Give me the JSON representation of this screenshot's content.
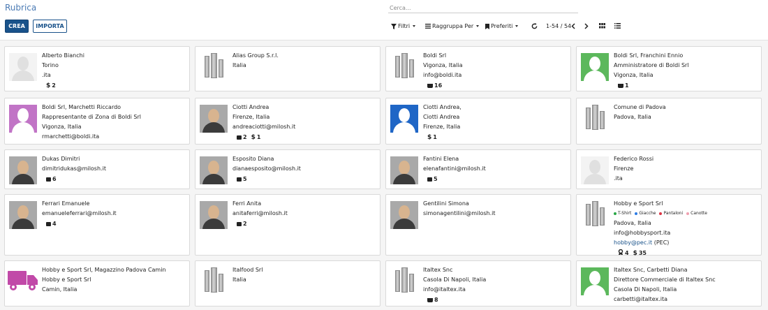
{
  "title": "Rubrica",
  "search": {
    "placeholder": "Cerca..."
  },
  "buttons": {
    "create": "CREA",
    "import": "IMPORTA"
  },
  "toolbar": {
    "filters": "Filtri",
    "group_by": "Raggruppa Per",
    "favorites": "Preferiti",
    "pager": "1-54 / 54"
  },
  "cards": [
    {
      "name": "Alberto Bianchi",
      "lines": [
        "Torino",
        ".ita"
      ],
      "badges": [
        {
          "icon": "dollar-icon",
          "value": "2"
        }
      ],
      "avatar": "person",
      "email": ""
    },
    {
      "name": "Alias Group S.r.l.",
      "lines": [
        "Italia"
      ],
      "badges": [],
      "avatar": "company",
      "email": ""
    },
    {
      "name": "Boldi Srl",
      "lines": [
        "Vigonza, Italia"
      ],
      "email": "info@boldi.ita",
      "badges": [
        {
          "icon": "cart-icon",
          "value": "16"
        }
      ],
      "avatar": "company"
    },
    {
      "name": "Boldi Srl, Franchini Ennio",
      "lines": [
        "Amministratore di Boldi Srl",
        "Vigonza, Italia"
      ],
      "email": "",
      "badges": [
        {
          "icon": "cart-icon",
          "value": "1"
        }
      ],
      "avatar": "green"
    },
    {
      "name": "Boldi Srl, Marchetti Riccardo",
      "lines": [
        "Rappresentante di Zona di Boldi Srl",
        "Vigonza, Italia"
      ],
      "email": "rmarchetti@boldi.ita",
      "badges": [],
      "avatar": "purple"
    },
    {
      "name": "Ciotti Andrea",
      "lines": [
        "Firenze, Italia"
      ],
      "email": "andreaciotti@milosh.it",
      "badges": [
        {
          "icon": "calendar-icon",
          "value": "2"
        },
        {
          "icon": "dollar-icon",
          "value": "1"
        }
      ],
      "avatar": "photo"
    },
    {
      "name": "Ciotti Andrea,",
      "lines": [
        "Ciotti Andrea",
        "Firenze, Italia"
      ],
      "email": "",
      "badges": [
        {
          "icon": "dollar-icon",
          "value": "1"
        }
      ],
      "avatar": "blue"
    },
    {
      "name": "Comune di Padova",
      "lines": [
        "Padova, Italia"
      ],
      "email": "",
      "badges": [],
      "avatar": "company"
    },
    {
      "name": "Dukas Dimitri",
      "lines": [],
      "email": "dimitridukas@milosh.it",
      "badges": [
        {
          "icon": "calendar-icon",
          "value": "6"
        }
      ],
      "avatar": "photo"
    },
    {
      "name": "Esposito Diana",
      "lines": [],
      "email": "dianaesposito@milosh.it",
      "badges": [
        {
          "icon": "calendar-icon",
          "value": "5"
        }
      ],
      "avatar": "photo"
    },
    {
      "name": "Fantini Elena",
      "lines": [],
      "email": "elenafantini@milosh.it",
      "badges": [
        {
          "icon": "calendar-icon",
          "value": "5"
        }
      ],
      "avatar": "photo"
    },
    {
      "name": "Federico Rossi",
      "lines": [
        "Firenze",
        ".ita"
      ],
      "email": "",
      "badges": [],
      "avatar": "person"
    },
    {
      "name": "Ferrari Emanuele",
      "lines": [],
      "email": "emanueleferrari@milosh.it",
      "badges": [
        {
          "icon": "calendar-icon",
          "value": "4"
        }
      ],
      "avatar": "photo"
    },
    {
      "name": "Ferri Anita",
      "lines": [],
      "email": "anitaferri@milosh.it",
      "badges": [
        {
          "icon": "calendar-icon",
          "value": "2"
        }
      ],
      "avatar": "photo"
    },
    {
      "name": "Gentilini Simona",
      "lines": [],
      "email": "simonagentilini@milosh.it",
      "badges": [],
      "avatar": "photo"
    },
    {
      "name": "Hobby e Sport Srl",
      "tags": [
        {
          "label": "T-Shirt",
          "color": "#28a745"
        },
        {
          "label": "Giacche",
          "color": "#2c7be5"
        },
        {
          "label": "Pantaloni",
          "color": "#dc3545"
        },
        {
          "label": "Canotte",
          "color": "#f0a0b0"
        }
      ],
      "lines": [
        "Padova, Italia"
      ],
      "email": "info@hobbysport.ita",
      "pec": "hobby@pec.it",
      "pec_suffix": "(PEC)",
      "badges": [
        {
          "icon": "trophy-icon",
          "value": "4"
        },
        {
          "icon": "dollar-icon",
          "value": "35"
        }
      ],
      "avatar": "company"
    },
    {
      "name": "Hobby e Sport Srl, Magazzino Padova Camin",
      "lines": [
        "Hobby e Sport Srl",
        "Camin, Italia"
      ],
      "email": "",
      "badges": [],
      "avatar": "truck"
    },
    {
      "name": "Italfood Srl",
      "lines": [
        "Italia"
      ],
      "email": "",
      "badges": [],
      "avatar": "company"
    },
    {
      "name": "Italtex Snc",
      "lines": [
        "Casola Di Napoli, Italia"
      ],
      "email": "info@italtex.ita",
      "badges": [
        {
          "icon": "cart-icon",
          "value": "8"
        }
      ],
      "avatar": "company"
    },
    {
      "name": "Italtex Snc, Carbetti Diana",
      "lines": [
        "Direttore Commerciale di Italtex Snc",
        "Casola Di Napoli, Italia"
      ],
      "email": "carbetti@italtex.ita",
      "badges": [],
      "avatar": "green"
    }
  ]
}
